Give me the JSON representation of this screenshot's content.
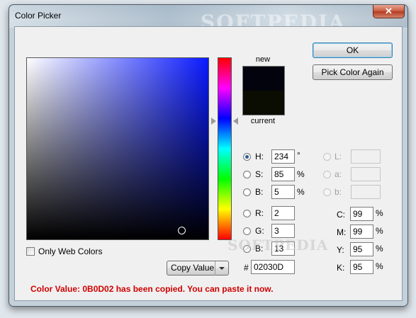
{
  "window": {
    "title": "Color Picker",
    "close_glyph": "✕",
    "watermark": "SOFTPEDIA",
    "watermark_client": "SOFTPEDIA"
  },
  "buttons": {
    "ok_label": "OK",
    "pick_again_label": "Pick Color Again",
    "copy_value_label": "Copy Value"
  },
  "preview": {
    "new_label": "new",
    "current_label": "current",
    "new_color": "#02030D",
    "current_color": "#0B0D02"
  },
  "color_field": {
    "hue_color": "#0a1aff",
    "cursor_s_fraction": 0.85,
    "cursor_b_fraction": 0.05
  },
  "hue_slider": {
    "hue_degrees": 234
  },
  "hsb": {
    "h_label": "H:",
    "h_value": "234",
    "h_unit": "°",
    "s_label": "S:",
    "s_value": "85",
    "s_unit": "%",
    "b_label": "B:",
    "b_value": "5",
    "b_unit": "%"
  },
  "rgb": {
    "r_label": "R:",
    "r_value": "2",
    "g_label": "G:",
    "g_value": "3",
    "b_label": "B:",
    "b_value": "13"
  },
  "lab": {
    "l_label": "L:",
    "l_value": "",
    "a_label": "a:",
    "a_value": "",
    "b_label": "b:",
    "b_value": ""
  },
  "cmyk": {
    "c_label": "C:",
    "c_value": "99",
    "c_unit": "%",
    "m_label": "M:",
    "m_value": "99",
    "m_unit": "%",
    "y_label": "Y:",
    "y_value": "95",
    "y_unit": "%",
    "k_label": "K:",
    "k_value": "95",
    "k_unit": "%"
  },
  "hex": {
    "hash_label": "#",
    "value": "02030D"
  },
  "web_colors": {
    "label": "Only Web Colors",
    "checked": false
  },
  "status_message": "Color Value: 0B0D02 has been copied. You can paste it now."
}
